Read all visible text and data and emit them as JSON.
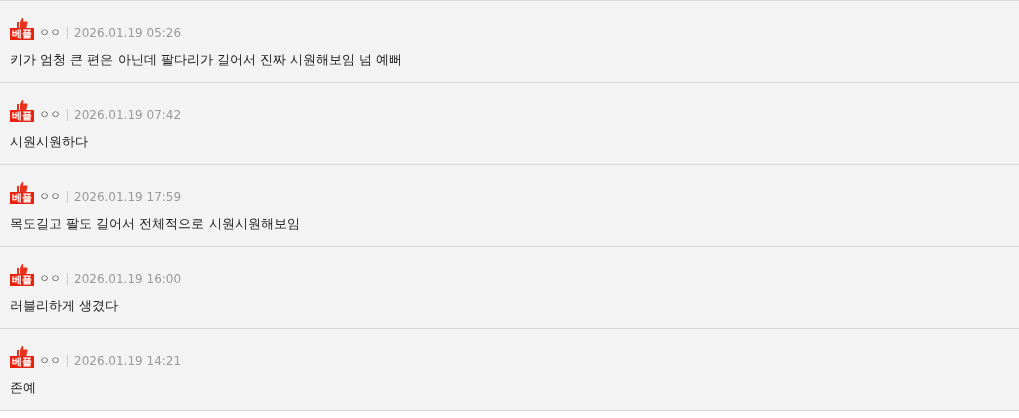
{
  "comments": [
    {
      "badge": "베플",
      "author": "ㅇㅇ",
      "date": "2026.01.19 05:26",
      "text": "키가 엄청 큰 편은 아닌데 팔다리가 길어서 진짜 시원해보임 넘 예뻐"
    },
    {
      "badge": "베플",
      "author": "ㅇㅇ",
      "date": "2026.01.19 07:42",
      "text": "시원시원하다"
    },
    {
      "badge": "베플",
      "author": "ㅇㅇ",
      "date": "2026.01.19 17:59",
      "text": "목도길고 팔도 길어서 전체적으로 시원시원해보임"
    },
    {
      "badge": "베플",
      "author": "ㅇㅇ",
      "date": "2026.01.19 16:00",
      "text": "러블리하게 생겼다"
    },
    {
      "badge": "베플",
      "author": "ㅇㅇ",
      "date": "2026.01.19 14:21",
      "text": "존예"
    }
  ]
}
